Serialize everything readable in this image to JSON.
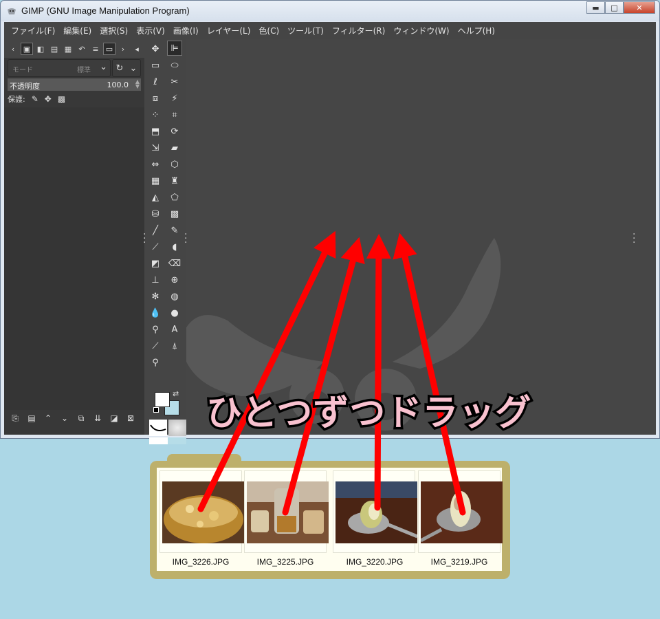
{
  "window": {
    "title": "GIMP (GNU Image Manipulation Program)",
    "minimize_glyph": "▬",
    "maximize_glyph": "□",
    "close_glyph": "✕"
  },
  "menu": [
    {
      "label": "ファイル(F)"
    },
    {
      "label": "編集(E)"
    },
    {
      "label": "選択(S)"
    },
    {
      "label": "表示(V)"
    },
    {
      "label": "画像(I)"
    },
    {
      "label": "レイヤー(L)"
    },
    {
      "label": "色(C)"
    },
    {
      "label": "ツール(T)"
    },
    {
      "label": "フィルター(R)"
    },
    {
      "label": "ウィンドウ(W)"
    },
    {
      "label": "ヘルプ(H)"
    }
  ],
  "layers": {
    "mode_placeholder": "モード",
    "mode_value": "標準",
    "opacity_label": "不透明度",
    "opacity_value": "100.0",
    "protect_label": "保護:"
  },
  "colors": {
    "foreground": "#ffffff",
    "background": "#b6dde8",
    "annotation_text": "#f9c1cf",
    "arrow": "#ff0000",
    "folder": "#bdb06b"
  },
  "annotation": {
    "headline": "ひとつずつドラッグ"
  },
  "files": [
    {
      "name": "IMG_3226.JPG",
      "icon": "jam-jar-photo"
    },
    {
      "name": "IMG_3225.JPG",
      "icon": "glass-jars-photo"
    },
    {
      "name": "IMG_3220.JPG",
      "icon": "spoon-fruit-photo"
    },
    {
      "name": "IMG_3219.JPG",
      "icon": "spoon-fruit-photo-2"
    }
  ]
}
